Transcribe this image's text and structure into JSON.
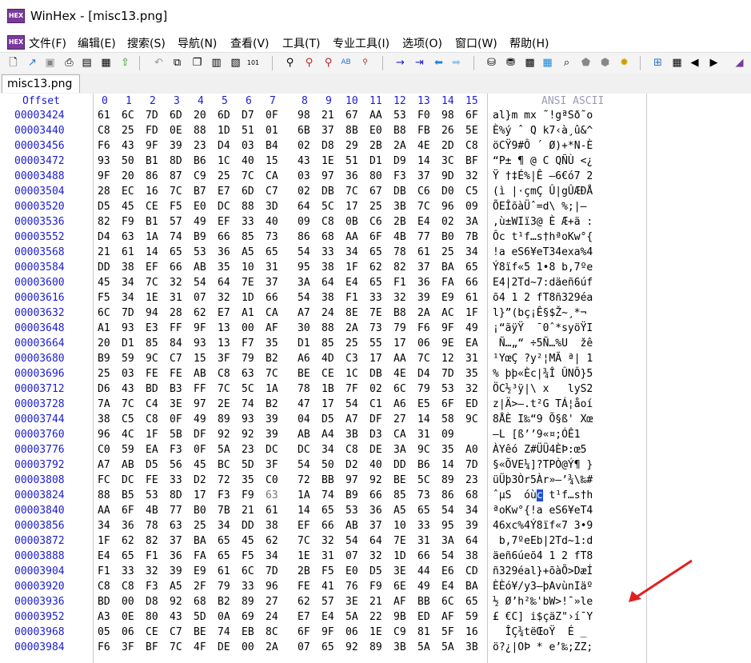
{
  "window": {
    "title": "WinHex - [misc13.png]",
    "icon_label": "HEX"
  },
  "menu": [
    "文件(F)",
    "编辑(E)",
    "搜索(S)",
    "导航(N)",
    "查看(V)",
    "工具(T)",
    "专业工具(I)",
    "选项(O)",
    "窗口(W)",
    "帮助(H)"
  ],
  "tab": {
    "label": "misc13.png"
  },
  "header": {
    "offset": "Offset",
    "columns": [
      "0",
      "1",
      "2",
      "3",
      "4",
      "5",
      "6",
      "7",
      "8",
      "9",
      "10",
      "11",
      "12",
      "13",
      "14",
      "15"
    ],
    "ansi": "ANSI ASCII"
  },
  "selection": {
    "row": 25,
    "col": 7
  },
  "rows": [
    {
      "offset": "00003424",
      "hex": [
        "61",
        "6C",
        "7D",
        "6D",
        "20",
        "6D",
        "D7",
        "0F",
        "98",
        "21",
        "67",
        "AA",
        "53",
        "F0",
        "98",
        "6F"
      ],
      "ansi": "al}m mx ˜!gªSð˜o"
    },
    {
      "offset": "00003440",
      "hex": [
        "C8",
        "25",
        "FD",
        "0E",
        "88",
        "1D",
        "51",
        "01",
        "6B",
        "37",
        "8B",
        "E0",
        "B8",
        "FB",
        "26",
        "5E"
      ],
      "ansi": "È%ý ˆ Q k7‹à¸û&^"
    },
    {
      "offset": "00003456",
      "hex": [
        "F6",
        "43",
        "9F",
        "39",
        "23",
        "D4",
        "03",
        "B4",
        "02",
        "D8",
        "29",
        "2B",
        "2A",
        "4E",
        "2D",
        "C8"
      ],
      "ansi": "öCŸ9#Ô ´ Ø)+*N-È"
    },
    {
      "offset": "00003472",
      "hex": [
        "93",
        "50",
        "B1",
        "8D",
        "B6",
        "1C",
        "40",
        "15",
        "43",
        "1E",
        "51",
        "D1",
        "D9",
        "14",
        "3C",
        "BF"
      ],
      "ansi": "“P± ¶ @ C QÑÙ <¿"
    },
    {
      "offset": "00003488",
      "hex": [
        "9F",
        "20",
        "86",
        "87",
        "C9",
        "25",
        "7C",
        "CA",
        "03",
        "97",
        "36",
        "80",
        "F3",
        "37",
        "9D",
        "32"
      ],
      "ansi": "Ÿ †‡É%|Ê —6€ó7 2"
    },
    {
      "offset": "00003504",
      "hex": [
        "28",
        "EC",
        "16",
        "7C",
        "B7",
        "E7",
        "6D",
        "C7",
        "02",
        "DB",
        "7C",
        "67",
        "DB",
        "C6",
        "D0",
        "C5"
      ],
      "ansi": "(ì |·çmÇ Û|gÛÆÐÅ"
    },
    {
      "offset": "00003520",
      "hex": [
        "D5",
        "45",
        "CE",
        "F5",
        "E0",
        "DC",
        "88",
        "3D",
        "64",
        "5C",
        "17",
        "25",
        "3B",
        "7C",
        "96",
        "09"
      ],
      "ansi": "ÕEÎõàÜˆ=d\\ %;|– "
    },
    {
      "offset": "00003536",
      "hex": [
        "82",
        "F9",
        "B1",
        "57",
        "49",
        "EF",
        "33",
        "40",
        "09",
        "C8",
        "0B",
        "C6",
        "2B",
        "E4",
        "02",
        "3A"
      ],
      "ansi": "‚ù±WIï3@ È Æ+ä :"
    },
    {
      "offset": "00003552",
      "hex": [
        "D4",
        "63",
        "1A",
        "74",
        "B9",
        "66",
        "85",
        "73",
        "86",
        "68",
        "AA",
        "6F",
        "4B",
        "77",
        "B0",
        "7B"
      ],
      "ansi": "Ôc t¹f…s†hªoKw°{"
    },
    {
      "offset": "00003568",
      "hex": [
        "21",
        "61",
        "14",
        "65",
        "53",
        "36",
        "A5",
        "65",
        "54",
        "33",
        "34",
        "65",
        "78",
        "61",
        "25",
        "34"
      ],
      "ansi": "!a eS6¥eT34exa%4"
    },
    {
      "offset": "00003584",
      "hex": [
        "DD",
        "38",
        "EF",
        "66",
        "AB",
        "35",
        "10",
        "31",
        "95",
        "38",
        "1F",
        "62",
        "82",
        "37",
        "BA",
        "65"
      ],
      "ansi": "Ý8ïf«5 1•8 b‚7ºe"
    },
    {
      "offset": "00003600",
      "hex": [
        "45",
        "34",
        "7C",
        "32",
        "54",
        "64",
        "7E",
        "37",
        "3A",
        "64",
        "E4",
        "65",
        "F1",
        "36",
        "FA",
        "66"
      ],
      "ansi": "E4|2Td~7:däeñ6úf"
    },
    {
      "offset": "00003616",
      "hex": [
        "F5",
        "34",
        "1E",
        "31",
        "07",
        "32",
        "1D",
        "66",
        "54",
        "38",
        "F1",
        "33",
        "32",
        "39",
        "E9",
        "61"
      ],
      "ansi": "õ4 1 2 fT8ñ329éa"
    },
    {
      "offset": "00003632",
      "hex": [
        "6C",
        "7D",
        "94",
        "28",
        "62",
        "E7",
        "A1",
        "CA",
        "A7",
        "24",
        "8E",
        "7E",
        "B8",
        "2A",
        "AC",
        "1F"
      ],
      "ansi": "l}”(bç¡Ê§$Ž~¸*¬ "
    },
    {
      "offset": "00003648",
      "hex": [
        "A1",
        "93",
        "E3",
        "FF",
        "9F",
        "13",
        "00",
        "AF",
        "30",
        "88",
        "2A",
        "73",
        "79",
        "F6",
        "9F",
        "49"
      ],
      "ansi": "¡“ãÿŸ  ¯0ˆ*syöŸI"
    },
    {
      "offset": "00003664",
      "hex": [
        "20",
        "D1",
        "85",
        "84",
        "93",
        "13",
        "F7",
        "35",
        "D1",
        "85",
        "25",
        "55",
        "17",
        "06",
        "9E",
        "EA"
      ],
      "ansi": " Ñ…„“ ÷5Ñ…%U  žê"
    },
    {
      "offset": "00003680",
      "hex": [
        "B9",
        "59",
        "9C",
        "C7",
        "15",
        "3F",
        "79",
        "B2",
        "A6",
        "4D",
        "C3",
        "17",
        "AA",
        "7C",
        "12",
        "31"
      ],
      "ansi": "¹YœÇ ?y²¦MÃ ª| 1"
    },
    {
      "offset": "00003696",
      "hex": [
        "25",
        "03",
        "FE",
        "FE",
        "AB",
        "C8",
        "63",
        "7C",
        "BE",
        "CE",
        "1C",
        "DB",
        "4E",
        "D4",
        "7D",
        "35"
      ],
      "ansi": "% þþ«Èc|¾Î ÛNÔ}5"
    },
    {
      "offset": "00003712",
      "hex": [
        "D6",
        "43",
        "BD",
        "B3",
        "FF",
        "7C",
        "5C",
        "1A",
        "78",
        "1B",
        "7F",
        "02",
        "6C",
        "79",
        "53",
        "32"
      ],
      "ansi": "ÖC½³ÿ|\\ x   lyS2"
    },
    {
      "offset": "00003728",
      "hex": [
        "7A",
        "7C",
        "C4",
        "3E",
        "97",
        "2E",
        "74",
        "B2",
        "47",
        "17",
        "54",
        "C1",
        "A6",
        "E5",
        "6F",
        "ED"
      ],
      "ansi": "z|Ä>—.t²G TÁ¦åoí"
    },
    {
      "offset": "00003744",
      "hex": [
        "38",
        "C5",
        "C8",
        "0F",
        "49",
        "89",
        "93",
        "39",
        "04",
        "D5",
        "A7",
        "DF",
        "27",
        "14",
        "58",
        "9C"
      ],
      "ansi": "8ÅÈ I‰“9 Õ§ß' Xœ"
    },
    {
      "offset": "00003760",
      "hex": [
        "96",
        "4C",
        "1F",
        "5B",
        "DF",
        "92",
        "92",
        "39",
        "AB",
        "A4",
        "3B",
        "D3",
        "CA",
        "31",
        "09"
      ],
      "ansi": "–L [ß’’9«¤;ÓÊ1"
    },
    {
      "offset": "00003776",
      "hex": [
        "C0",
        "59",
        "EA",
        "F3",
        "0F",
        "5A",
        "23",
        "DC",
        "DC",
        "34",
        "C8",
        "DE",
        "3A",
        "9C",
        "35",
        "A0"
      ],
      "ansi": "ÀYêó Z#ÜÜ4ÈÞ:œ5 "
    },
    {
      "offset": "00003792",
      "hex": [
        "A7",
        "AB",
        "D5",
        "56",
        "45",
        "BC",
        "5D",
        "3F",
        "54",
        "50",
        "D2",
        "40",
        "DD",
        "B6",
        "14",
        "7D"
      ],
      "ansi": "§«ÕVE¼]?TPÒ@Ý¶ }"
    },
    {
      "offset": "00003808",
      "hex": [
        "FC",
        "DC",
        "FE",
        "33",
        "D2",
        "72",
        "35",
        "C0",
        "72",
        "BB",
        "97",
        "92",
        "BE",
        "5C",
        "89",
        "23"
      ],
      "ansi": "üÜþ3Òr5Àr»—’¾\\‰#"
    },
    {
      "offset": "00003824",
      "hex": [
        "88",
        "B5",
        "53",
        "8D",
        "17",
        "F3",
        "F9",
        "63",
        "1A",
        "74",
        "B9",
        "66",
        "85",
        "73",
        "86",
        "68"
      ],
      "ansi": "ˆµS  óùc t¹f…s†h"
    },
    {
      "offset": "00003840",
      "hex": [
        "AA",
        "6F",
        "4B",
        "77",
        "B0",
        "7B",
        "21",
        "61",
        "14",
        "65",
        "53",
        "36",
        "A5",
        "65",
        "54",
        "34"
      ],
      "ansi": "ªoKw°{!a eS6¥eT4"
    },
    {
      "offset": "00003856",
      "hex": [
        "34",
        "36",
        "78",
        "63",
        "25",
        "34",
        "DD",
        "38",
        "EF",
        "66",
        "AB",
        "37",
        "10",
        "33",
        "95",
        "39"
      ],
      "ansi": "46xc%4Ý8ïf«7 3•9"
    },
    {
      "offset": "00003872",
      "hex": [
        "1F",
        "62",
        "82",
        "37",
        "BA",
        "65",
        "45",
        "62",
        "7C",
        "32",
        "54",
        "64",
        "7E",
        "31",
        "3A",
        "64"
      ],
      "ansi": " b‚7ºeEb|2Td~1:d"
    },
    {
      "offset": "00003888",
      "hex": [
        "E4",
        "65",
        "F1",
        "36",
        "FA",
        "65",
        "F5",
        "34",
        "1E",
        "31",
        "07",
        "32",
        "1D",
        "66",
        "54",
        "38"
      ],
      "ansi": "äeñ6úeõ4 1 2 fT8"
    },
    {
      "offset": "00003904",
      "hex": [
        "F1",
        "33",
        "32",
        "39",
        "E9",
        "61",
        "6C",
        "7D",
        "2B",
        "F5",
        "E0",
        "D5",
        "3E",
        "44",
        "E6",
        "CD"
      ],
      "ansi": "ñ329éal}+õàÕ>DæÍ"
    },
    {
      "offset": "00003920",
      "hex": [
        "C8",
        "C8",
        "F3",
        "A5",
        "2F",
        "79",
        "33",
        "96",
        "FE",
        "41",
        "76",
        "F9",
        "6E",
        "49",
        "E4",
        "BA"
      ],
      "ansi": "ÈÈó¥/y3–þAvùnIäº"
    },
    {
      "offset": "00003936",
      "hex": [
        "BD",
        "00",
        "D8",
        "92",
        "68",
        "B2",
        "89",
        "27",
        "62",
        "57",
        "3E",
        "21",
        "AF",
        "BB",
        "6C",
        "65"
      ],
      "ansi": "½ Ø’h²‰'bW>!¯»le"
    },
    {
      "offset": "00003952",
      "hex": [
        "A3",
        "0E",
        "80",
        "43",
        "5D",
        "0A",
        "69",
        "24",
        "E7",
        "E4",
        "5A",
        "22",
        "9B",
        "ED",
        "AF",
        "59"
      ],
      "ansi": "£ €C] i$çäZ\"›í¯Y"
    },
    {
      "offset": "00003968",
      "hex": [
        "05",
        "06",
        "CE",
        "C7",
        "BE",
        "74",
        "EB",
        "8C",
        "6F",
        "9F",
        "06",
        "1E",
        "C9",
        "81",
        "5F",
        "16"
      ],
      "ansi": "  ÎÇ¾tëŒoŸ  É _ "
    },
    {
      "offset": "00003984",
      "hex": [
        "F6",
        "3F",
        "BF",
        "7C",
        "4F",
        "DE",
        "00",
        "2A",
        "07",
        "65",
        "92",
        "89",
        "3B",
        "5A",
        "5A",
        "3B"
      ],
      "ansi": "ö?¿|OÞ * e’‰;ZZ;"
    }
  ]
}
